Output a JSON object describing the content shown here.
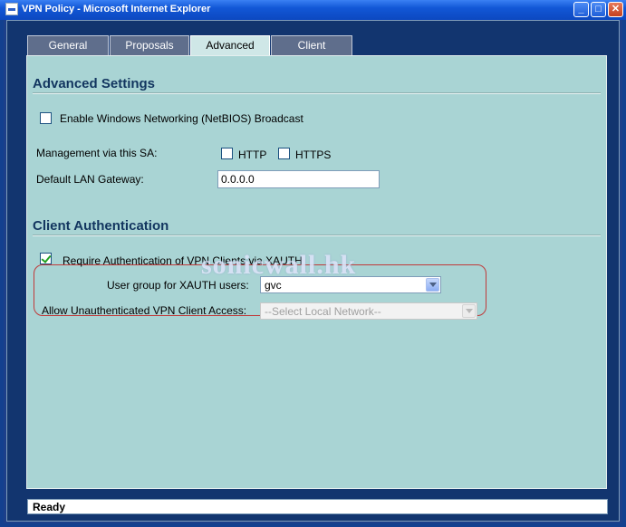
{
  "window": {
    "title": "VPN Policy - Microsoft Internet Explorer",
    "minimize_glyph": "_",
    "maximize_glyph": "□",
    "close_glyph": "✕"
  },
  "tabs": [
    {
      "label": "General",
      "active": false
    },
    {
      "label": "Proposals",
      "active": false
    },
    {
      "label": "Advanced",
      "active": true
    },
    {
      "label": "Client",
      "active": false
    }
  ],
  "advanced_settings": {
    "title": "Advanced Settings",
    "netbios": {
      "label": "Enable Windows Networking (NetBIOS) Broadcast",
      "checked": false
    },
    "management_label": "Management via this SA:",
    "http": {
      "label": "HTTP",
      "checked": false
    },
    "https": {
      "label": "HTTPS",
      "checked": false
    },
    "gateway_label": "Default LAN Gateway:",
    "gateway_value": "0.0.0.0"
  },
  "client_auth": {
    "title": "Client Authentication",
    "xauth": {
      "label": "Require Authentication of VPN Clients via XAUTH",
      "checked": true
    },
    "user_group_label": "User group for XAUTH users:",
    "user_group_value": "gvc",
    "unauth_label": "Allow Unauthenticated VPN Client Access:",
    "unauth_value": "--Select Local Network--",
    "highlight_color": "#c03a3a"
  },
  "watermark": "sonicwall.hk",
  "status": "Ready",
  "colors": {
    "panel_bg": "#a9d4d4",
    "titlebar": "#1257d6",
    "section_title": "#12355f"
  }
}
